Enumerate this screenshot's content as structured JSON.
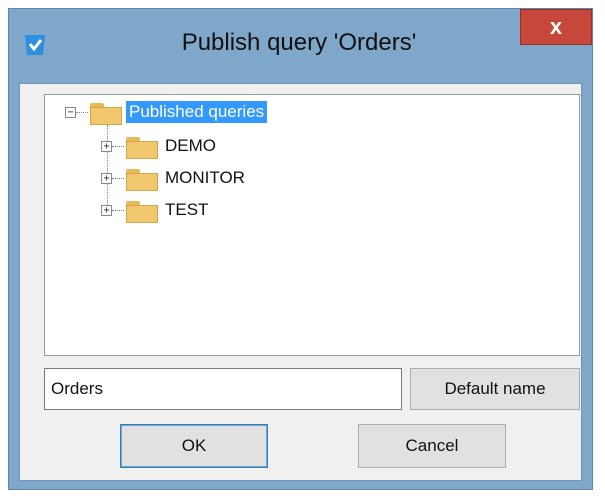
{
  "window": {
    "title": "Publish query 'Orders'",
    "close_label": "x"
  },
  "tree": {
    "root": {
      "label": "Published queries",
      "expander": "−"
    },
    "children": [
      {
        "label": "DEMO",
        "expander": "+"
      },
      {
        "label": "MONITOR",
        "expander": "+"
      },
      {
        "label": "TEST",
        "expander": "+"
      }
    ]
  },
  "name_field": {
    "value": "Orders"
  },
  "buttons": {
    "default_name": "Default name",
    "ok": "OK",
    "cancel": "Cancel"
  },
  "colors": {
    "selection": "#3399ff",
    "close": "#c7473a",
    "frame": "#7fa7c9"
  },
  "icons": {
    "app": "app-check-icon",
    "folder": "folder-icon"
  }
}
